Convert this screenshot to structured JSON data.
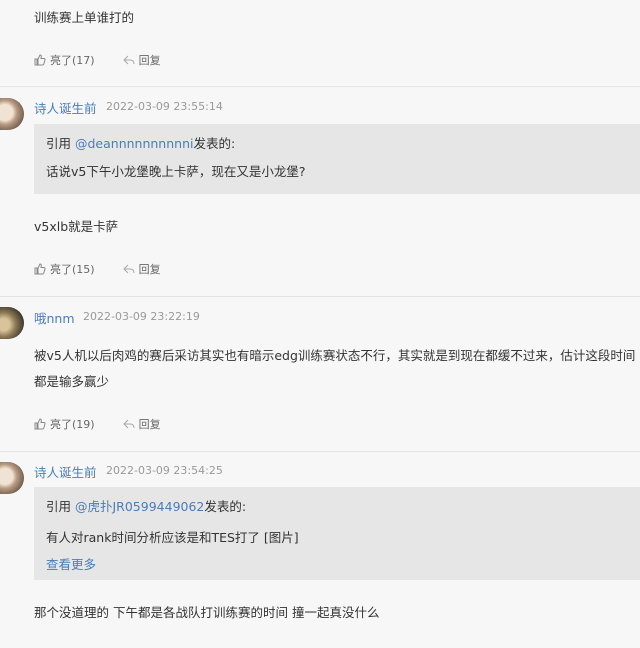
{
  "posts": [
    {
      "text": "训练赛上单谁打的",
      "likes": "亮了",
      "like_count": "(17)",
      "reply": "回复"
    },
    {
      "user": "诗人诞生前",
      "time": "2022-03-09 23:55:14",
      "quote": {
        "prefix": "引用 ",
        "handle": "@deannnnnnnnnni",
        "suffix": "发表的:",
        "text": "话说v5下午小龙堡晚上卡萨，现在又是小龙堡?"
      },
      "text": "v5xlb就是卡萨",
      "likes": "亮了",
      "like_count": "(15)",
      "reply": "回复"
    },
    {
      "user": "哦nnm",
      "time": "2022-03-09 23:22:19",
      "text_lines": [
        "被v5人机以后肉鸡的赛后采访其实也有暗示edg训练赛状态不行，其实就是到现在都缓不过来，估计这段时间",
        "都是输多赢少"
      ],
      "likes": "亮了",
      "like_count": "(19)",
      "reply": "回复"
    },
    {
      "user": "诗人诞生前",
      "time": "2022-03-09 23:54:25",
      "quote": {
        "prefix": "引用 ",
        "handle": "@虎扑JR0599449062",
        "suffix": "发表的:",
        "text": "有人对rank时间分析应该是和TES打了 [图片]",
        "more": "查看更多"
      },
      "text": "那个没道理的 下午都是各战队打训练赛的时间 撞一起真没什么"
    }
  ],
  "colors": {
    "link": "#4a7db8",
    "quote_bg": "#e6e6e6",
    "page_bg": "#f7f7f7"
  },
  "icons": {
    "like": "thumbs-up-icon",
    "reply": "reply-arrow-icon"
  }
}
